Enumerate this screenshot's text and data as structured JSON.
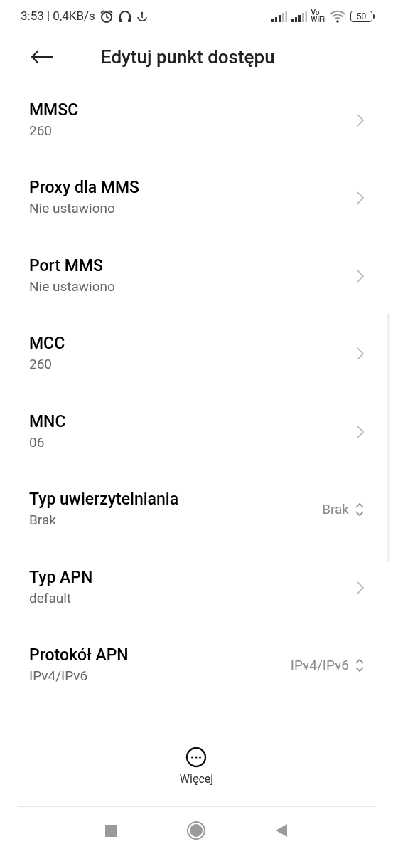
{
  "status_bar": {
    "time_speed": "3:53 | 0,4KB/s",
    "vowifi_top": "Vo",
    "vowifi_bottom": "WiFi",
    "battery": "50"
  },
  "header": {
    "title": "Edytuj punkt dostępu"
  },
  "items": [
    {
      "kind": "chevron",
      "title": "MMSC",
      "value": "260"
    },
    {
      "kind": "chevron",
      "title": "Proxy dla MMS",
      "value": "Nie ustawiono"
    },
    {
      "kind": "chevron",
      "title": "Port MMS",
      "value": "Nie ustawiono"
    },
    {
      "kind": "chevron",
      "title": "MCC",
      "value": "260"
    },
    {
      "kind": "chevron",
      "title": "MNC",
      "value": "06"
    },
    {
      "kind": "select",
      "title": "Typ uwierzytelniania",
      "value": "Brak",
      "selection": "Brak"
    },
    {
      "kind": "chevron",
      "title": "Typ APN",
      "value": "default"
    },
    {
      "kind": "select",
      "title": "Protokół APN",
      "value": "IPv4/IPv6",
      "selection": "IPv4/IPv6"
    }
  ],
  "more_button": {
    "label": "Więcej"
  }
}
